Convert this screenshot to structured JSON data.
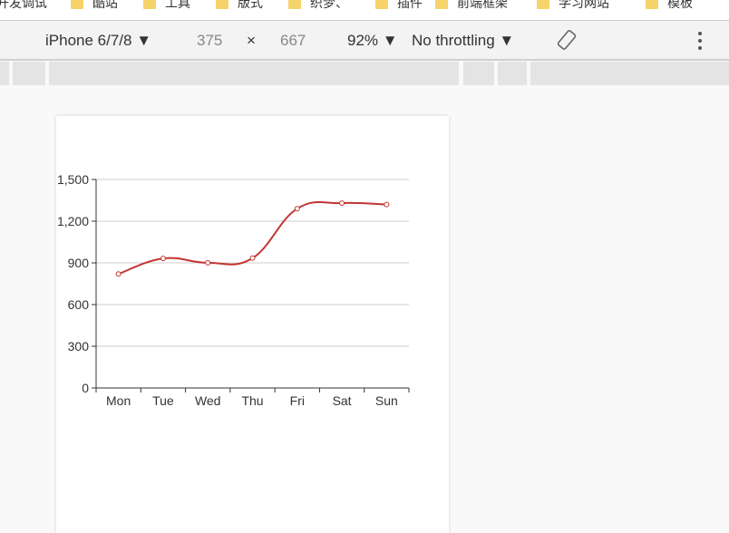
{
  "bookmarks": [
    "开发调试",
    "酷站",
    "工具",
    "版式",
    "织梦、",
    "插件",
    "前端框架",
    "学习网站",
    "模板"
  ],
  "toolbar": {
    "device": "iPhone 6/7/8 ▼",
    "width": "375",
    "times": "×",
    "height": "667",
    "zoom": "92% ▼",
    "throttling": "No throttling ▼",
    "rotate_icon": "rotate-icon",
    "menu_icon": "more-vert-icon"
  },
  "chart_data": {
    "type": "line",
    "smooth": true,
    "categories": [
      "Mon",
      "Tue",
      "Wed",
      "Thu",
      "Fri",
      "Sat",
      "Sun"
    ],
    "values": [
      820,
      932,
      901,
      934,
      1290,
      1330,
      1320
    ],
    "yticks": [
      "0",
      "300",
      "600",
      "900",
      "1,200",
      "1,500"
    ],
    "ylim": [
      0,
      1500
    ],
    "grid": true,
    "line_color": "#c23531"
  }
}
